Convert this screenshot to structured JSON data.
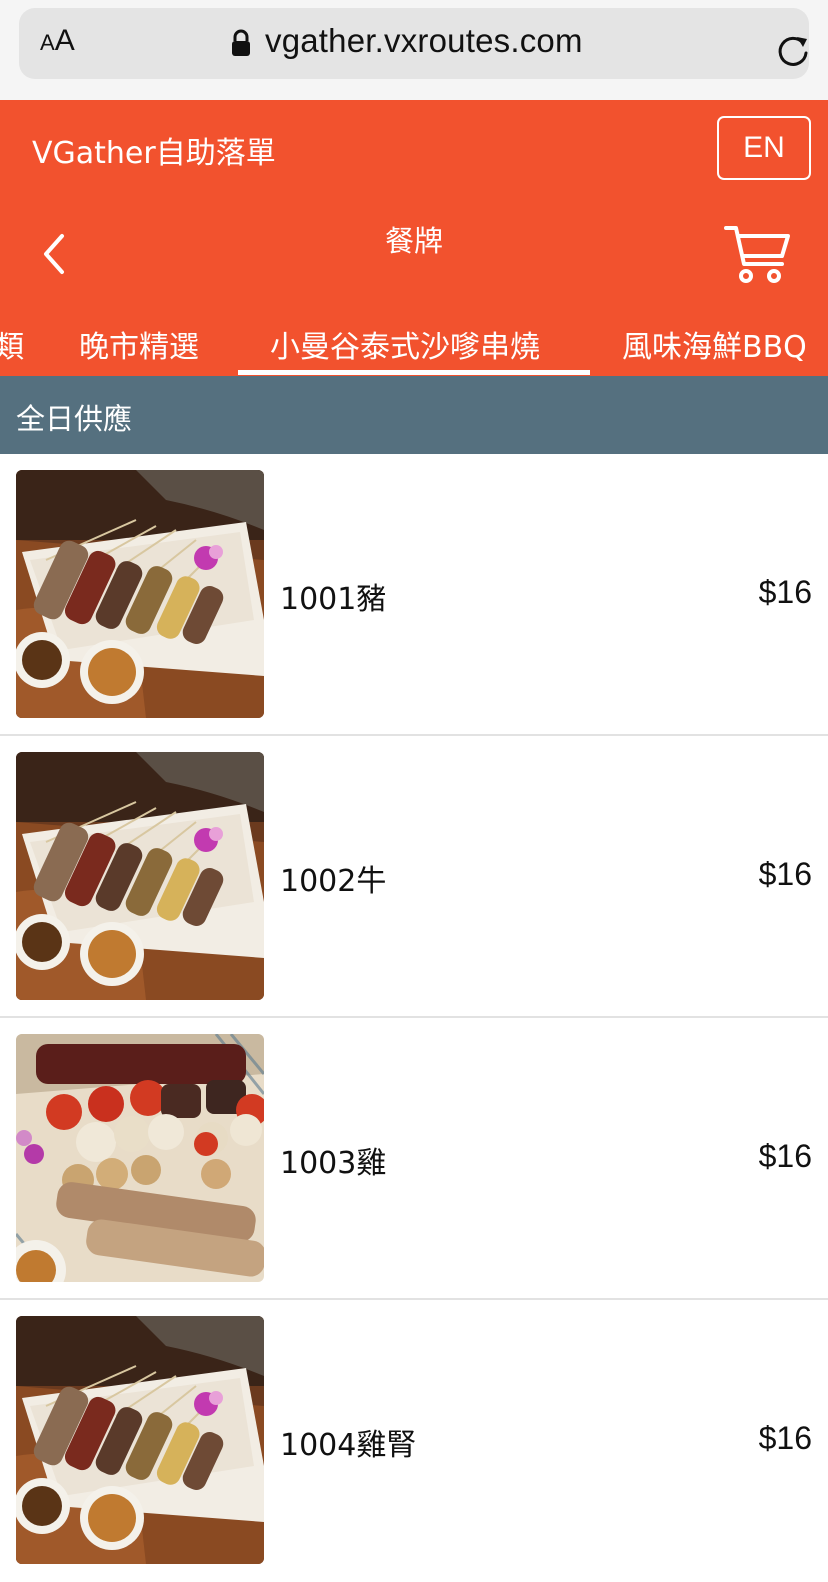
{
  "browser": {
    "text_size_small": "A",
    "text_size_large": "A",
    "url": "vgather.vxroutes.com",
    "icons": {
      "lock": "lock-icon",
      "reload": "reload-icon"
    }
  },
  "header": {
    "app_title": "VGather自助落單",
    "lang_button": "EN",
    "page_title": "餐牌",
    "icons": {
      "back": "chevron-left-icon",
      "cart": "cart-icon"
    },
    "accent_color": "#f2522e"
  },
  "tabs": [
    {
      "label": "類",
      "active": false
    },
    {
      "label": "晚市精選",
      "active": false
    },
    {
      "label": "小曼谷泰式沙嗲串燒",
      "active": true
    },
    {
      "label": "風味海鮮BBQ",
      "active": false
    }
  ],
  "section": {
    "title": "全日供應",
    "color": "#55707f"
  },
  "items": [
    {
      "name": "1001豬",
      "price": "$16",
      "image": "satay-platter"
    },
    {
      "name": "1002牛",
      "price": "$16",
      "image": "satay-platter"
    },
    {
      "name": "1003雞",
      "price": "$16",
      "image": "mixed-skewers"
    },
    {
      "name": "1004雞腎",
      "price": "$16",
      "image": "satay-platter"
    }
  ]
}
